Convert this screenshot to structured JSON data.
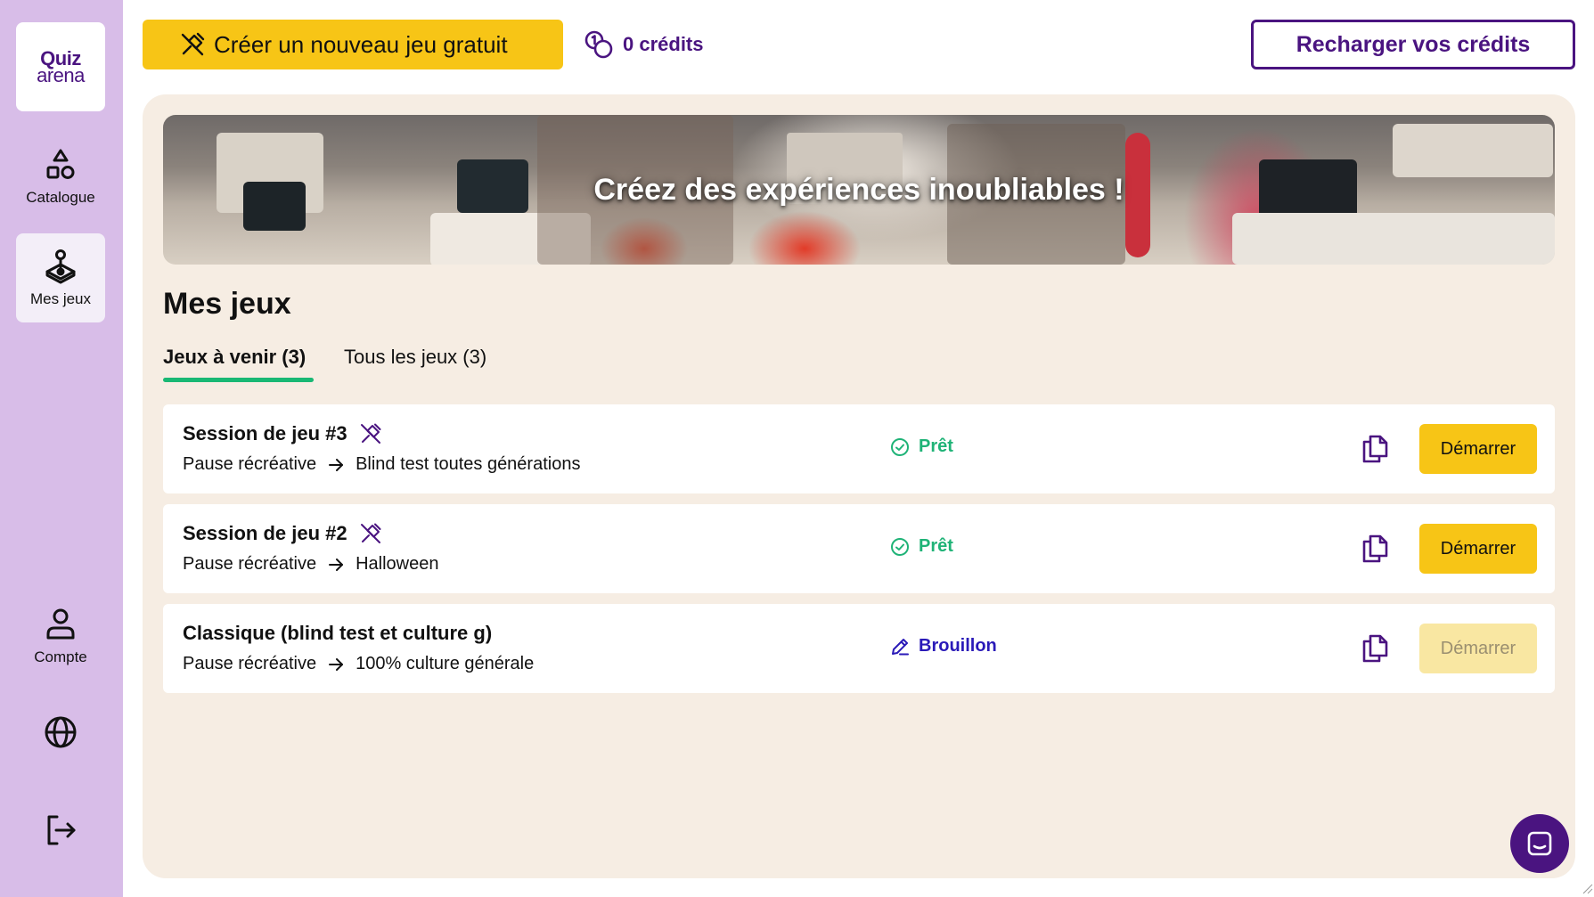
{
  "app": {
    "logo_line1": "Quiz",
    "logo_line2": "arena"
  },
  "sidebar": {
    "items": [
      {
        "label": "Catalogue",
        "icon": "shapes-icon"
      },
      {
        "label": "Mes jeux",
        "icon": "joystick-icon",
        "active": true
      },
      {
        "label": "Compte",
        "icon": "user-icon"
      }
    ],
    "language_icon": "globe-icon",
    "logout_icon": "logout-icon"
  },
  "topbar": {
    "create_label": "Créer un nouveau jeu gratuit",
    "credits_label": "0 crédits",
    "reload_label": "Recharger vos crédits"
  },
  "banner": {
    "title": "Créez des expériences inoubliables !"
  },
  "main": {
    "title": "Mes jeux",
    "tabs": [
      {
        "label": "Jeux à venir (3)",
        "active": true
      },
      {
        "label": "Tous les jeux (3)",
        "active": false
      }
    ],
    "games": [
      {
        "title": "Session de jeu #3",
        "free": true,
        "category": "Pause récréative",
        "theme": "Blind test toutes générations",
        "status": "Prêt",
        "status_type": "ready",
        "start_label": "Démarrer",
        "start_enabled": true
      },
      {
        "title": "Session de jeu #2",
        "free": true,
        "category": "Pause récréative",
        "theme": "Halloween",
        "status": "Prêt",
        "status_type": "ready",
        "start_label": "Démarrer",
        "start_enabled": true
      },
      {
        "title": "Classique (blind test et culture g)",
        "free": false,
        "category": "Pause récréative",
        "theme": "100% culture générale",
        "status": "Brouillon",
        "status_type": "draft",
        "start_label": "Démarrer",
        "start_enabled": false
      }
    ]
  },
  "colors": {
    "brand_purple": "#4a1480",
    "sidebar_bg": "#d8bde8",
    "accent_yellow": "#f7c516",
    "ready_green": "#1fb377",
    "draft_blue": "#2a1ab8",
    "panel_bg": "#f6ede3"
  }
}
